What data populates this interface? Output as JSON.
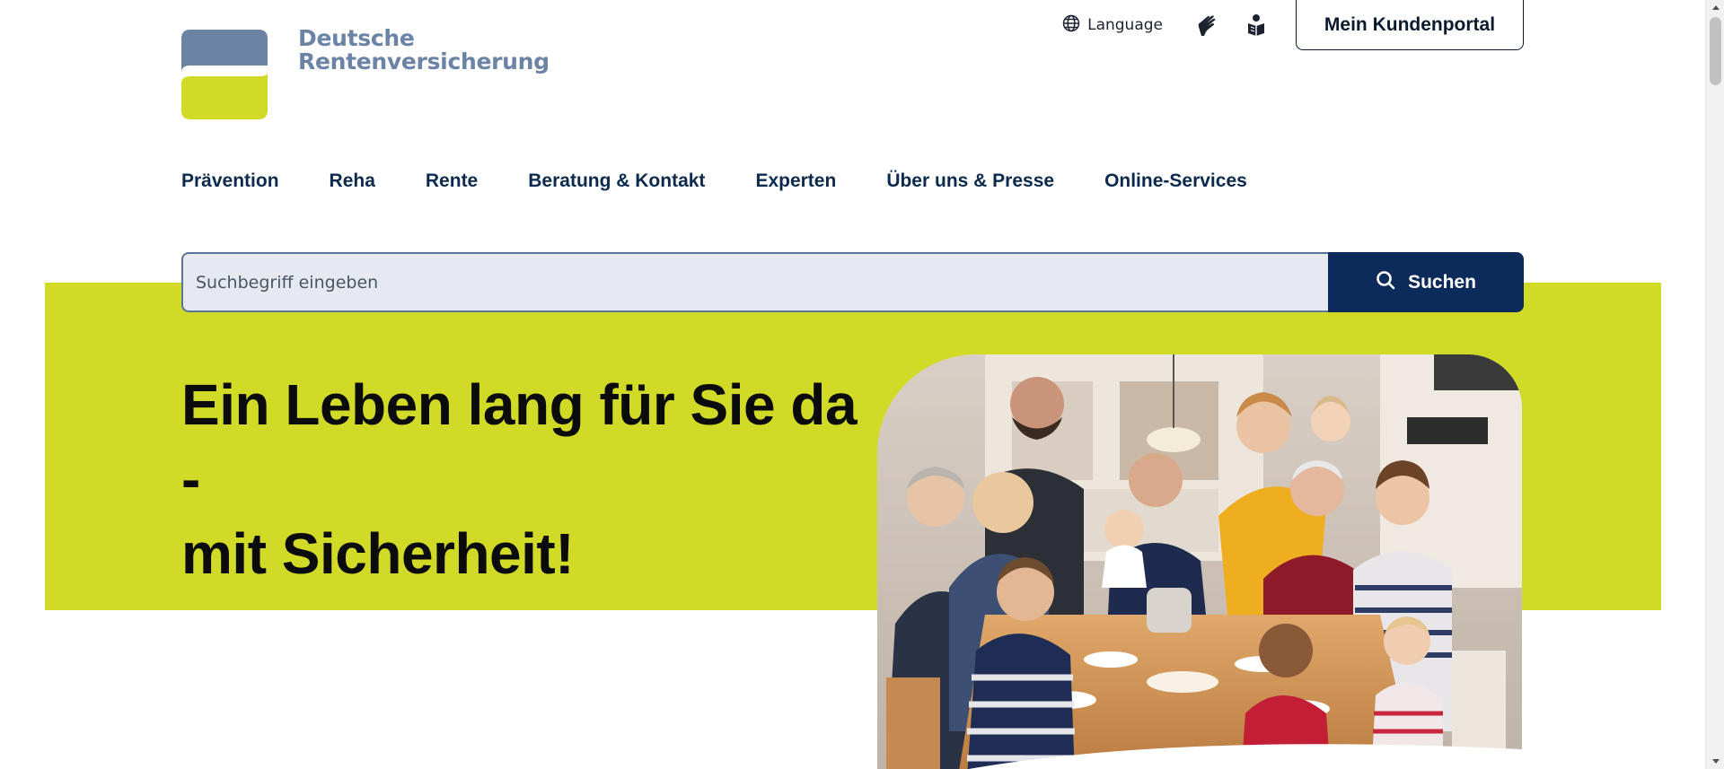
{
  "logo": {
    "line1": "Deutsche",
    "line2": "Rentenversicherung"
  },
  "utility": {
    "language_label": "Language",
    "portal_button": "Mein Kundenportal"
  },
  "icons": {
    "language": "globe-icon",
    "sign_language": "sign-language-icon",
    "easy_language": "easy-language-icon",
    "search": "search-icon"
  },
  "nav": [
    {
      "label": "Prävention"
    },
    {
      "label": "Reha"
    },
    {
      "label": "Rente"
    },
    {
      "label": "Beratung & Kontakt"
    },
    {
      "label": "Experten"
    },
    {
      "label": "Über uns & Presse"
    },
    {
      "label": "Online-Services"
    }
  ],
  "search": {
    "placeholder": "Suchbegriff eingeben",
    "button_label": "Suchen"
  },
  "hero": {
    "headline_line1": "Ein Leben lang für Sie da -",
    "headline_line2": "mit Sicherheit!"
  },
  "colors": {
    "brand_blue": "#6b84a6",
    "brand_green": "#d2da28",
    "navy": "#0c2a5a"
  }
}
